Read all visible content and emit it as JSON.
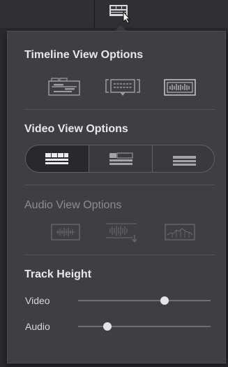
{
  "popup": {
    "timeline_view": {
      "title": "Timeline View Options",
      "icons": [
        "stacked-timelines-icon",
        "subtitle-tracks-icon",
        "waveform-view-icon"
      ]
    },
    "video_view": {
      "title": "Video View Options",
      "selected_index": 0,
      "options": [
        "filmstrip-view-icon",
        "thumbnail-view-icon",
        "simple-view-icon"
      ]
    },
    "audio_view": {
      "title": "Audio View Options",
      "enabled": false,
      "icons": [
        "audio-waveform-icon",
        "audio-waveform-scroll-icon",
        "audio-waveform-outline-icon"
      ]
    },
    "track_height": {
      "title": "Track Height",
      "video_label": "Video",
      "video_level": 0.65,
      "audio_label": "Audio",
      "audio_level": 0.22
    }
  },
  "colors": {
    "popup_bg": "#3f3f43",
    "title_text": "#e8e8ea",
    "dim_text": "#8c8c91",
    "thumb": "#e4e4e6"
  }
}
